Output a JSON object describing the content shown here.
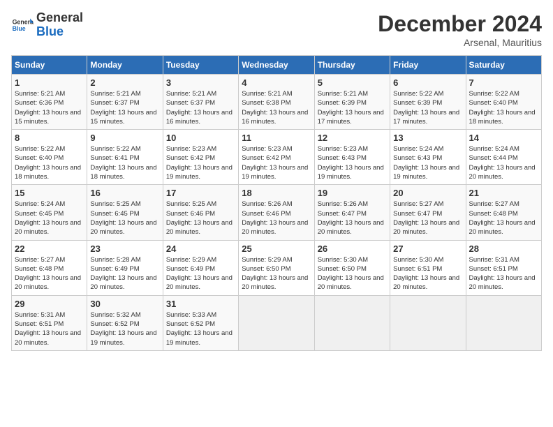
{
  "logo": {
    "general": "General",
    "blue": "Blue"
  },
  "title": "December 2024",
  "location": "Arsenal, Mauritius",
  "days_header": [
    "Sunday",
    "Monday",
    "Tuesday",
    "Wednesday",
    "Thursday",
    "Friday",
    "Saturday"
  ],
  "weeks": [
    [
      {
        "day": "1",
        "sunrise": "5:21 AM",
        "sunset": "6:36 PM",
        "daylight": "13 hours and 15 minutes."
      },
      {
        "day": "2",
        "sunrise": "5:21 AM",
        "sunset": "6:37 PM",
        "daylight": "13 hours and 15 minutes."
      },
      {
        "day": "3",
        "sunrise": "5:21 AM",
        "sunset": "6:37 PM",
        "daylight": "13 hours and 16 minutes."
      },
      {
        "day": "4",
        "sunrise": "5:21 AM",
        "sunset": "6:38 PM",
        "daylight": "13 hours and 16 minutes."
      },
      {
        "day": "5",
        "sunrise": "5:21 AM",
        "sunset": "6:39 PM",
        "daylight": "13 hours and 17 minutes."
      },
      {
        "day": "6",
        "sunrise": "5:22 AM",
        "sunset": "6:39 PM",
        "daylight": "13 hours and 17 minutes."
      },
      {
        "day": "7",
        "sunrise": "5:22 AM",
        "sunset": "6:40 PM",
        "daylight": "13 hours and 18 minutes."
      }
    ],
    [
      {
        "day": "8",
        "sunrise": "5:22 AM",
        "sunset": "6:40 PM",
        "daylight": "13 hours and 18 minutes."
      },
      {
        "day": "9",
        "sunrise": "5:22 AM",
        "sunset": "6:41 PM",
        "daylight": "13 hours and 18 minutes."
      },
      {
        "day": "10",
        "sunrise": "5:23 AM",
        "sunset": "6:42 PM",
        "daylight": "13 hours and 19 minutes."
      },
      {
        "day": "11",
        "sunrise": "5:23 AM",
        "sunset": "6:42 PM",
        "daylight": "13 hours and 19 minutes."
      },
      {
        "day": "12",
        "sunrise": "5:23 AM",
        "sunset": "6:43 PM",
        "daylight": "13 hours and 19 minutes."
      },
      {
        "day": "13",
        "sunrise": "5:24 AM",
        "sunset": "6:43 PM",
        "daylight": "13 hours and 19 minutes."
      },
      {
        "day": "14",
        "sunrise": "5:24 AM",
        "sunset": "6:44 PM",
        "daylight": "13 hours and 20 minutes."
      }
    ],
    [
      {
        "day": "15",
        "sunrise": "5:24 AM",
        "sunset": "6:45 PM",
        "daylight": "13 hours and 20 minutes."
      },
      {
        "day": "16",
        "sunrise": "5:25 AM",
        "sunset": "6:45 PM",
        "daylight": "13 hours and 20 minutes."
      },
      {
        "day": "17",
        "sunrise": "5:25 AM",
        "sunset": "6:46 PM",
        "daylight": "13 hours and 20 minutes."
      },
      {
        "day": "18",
        "sunrise": "5:26 AM",
        "sunset": "6:46 PM",
        "daylight": "13 hours and 20 minutes."
      },
      {
        "day": "19",
        "sunrise": "5:26 AM",
        "sunset": "6:47 PM",
        "daylight": "13 hours and 20 minutes."
      },
      {
        "day": "20",
        "sunrise": "5:27 AM",
        "sunset": "6:47 PM",
        "daylight": "13 hours and 20 minutes."
      },
      {
        "day": "21",
        "sunrise": "5:27 AM",
        "sunset": "6:48 PM",
        "daylight": "13 hours and 20 minutes."
      }
    ],
    [
      {
        "day": "22",
        "sunrise": "5:27 AM",
        "sunset": "6:48 PM",
        "daylight": "13 hours and 20 minutes."
      },
      {
        "day": "23",
        "sunrise": "5:28 AM",
        "sunset": "6:49 PM",
        "daylight": "13 hours and 20 minutes."
      },
      {
        "day": "24",
        "sunrise": "5:29 AM",
        "sunset": "6:49 PM",
        "daylight": "13 hours and 20 minutes."
      },
      {
        "day": "25",
        "sunrise": "5:29 AM",
        "sunset": "6:50 PM",
        "daylight": "13 hours and 20 minutes."
      },
      {
        "day": "26",
        "sunrise": "5:30 AM",
        "sunset": "6:50 PM",
        "daylight": "13 hours and 20 minutes."
      },
      {
        "day": "27",
        "sunrise": "5:30 AM",
        "sunset": "6:51 PM",
        "daylight": "13 hours and 20 minutes."
      },
      {
        "day": "28",
        "sunrise": "5:31 AM",
        "sunset": "6:51 PM",
        "daylight": "13 hours and 20 minutes."
      }
    ],
    [
      {
        "day": "29",
        "sunrise": "5:31 AM",
        "sunset": "6:51 PM",
        "daylight": "13 hours and 20 minutes."
      },
      {
        "day": "30",
        "sunrise": "5:32 AM",
        "sunset": "6:52 PM",
        "daylight": "13 hours and 19 minutes."
      },
      {
        "day": "31",
        "sunrise": "5:33 AM",
        "sunset": "6:52 PM",
        "daylight": "13 hours and 19 minutes."
      },
      null,
      null,
      null,
      null
    ]
  ],
  "labels": {
    "sunrise": "Sunrise:",
    "sunset": "Sunset:",
    "daylight": "Daylight:"
  }
}
